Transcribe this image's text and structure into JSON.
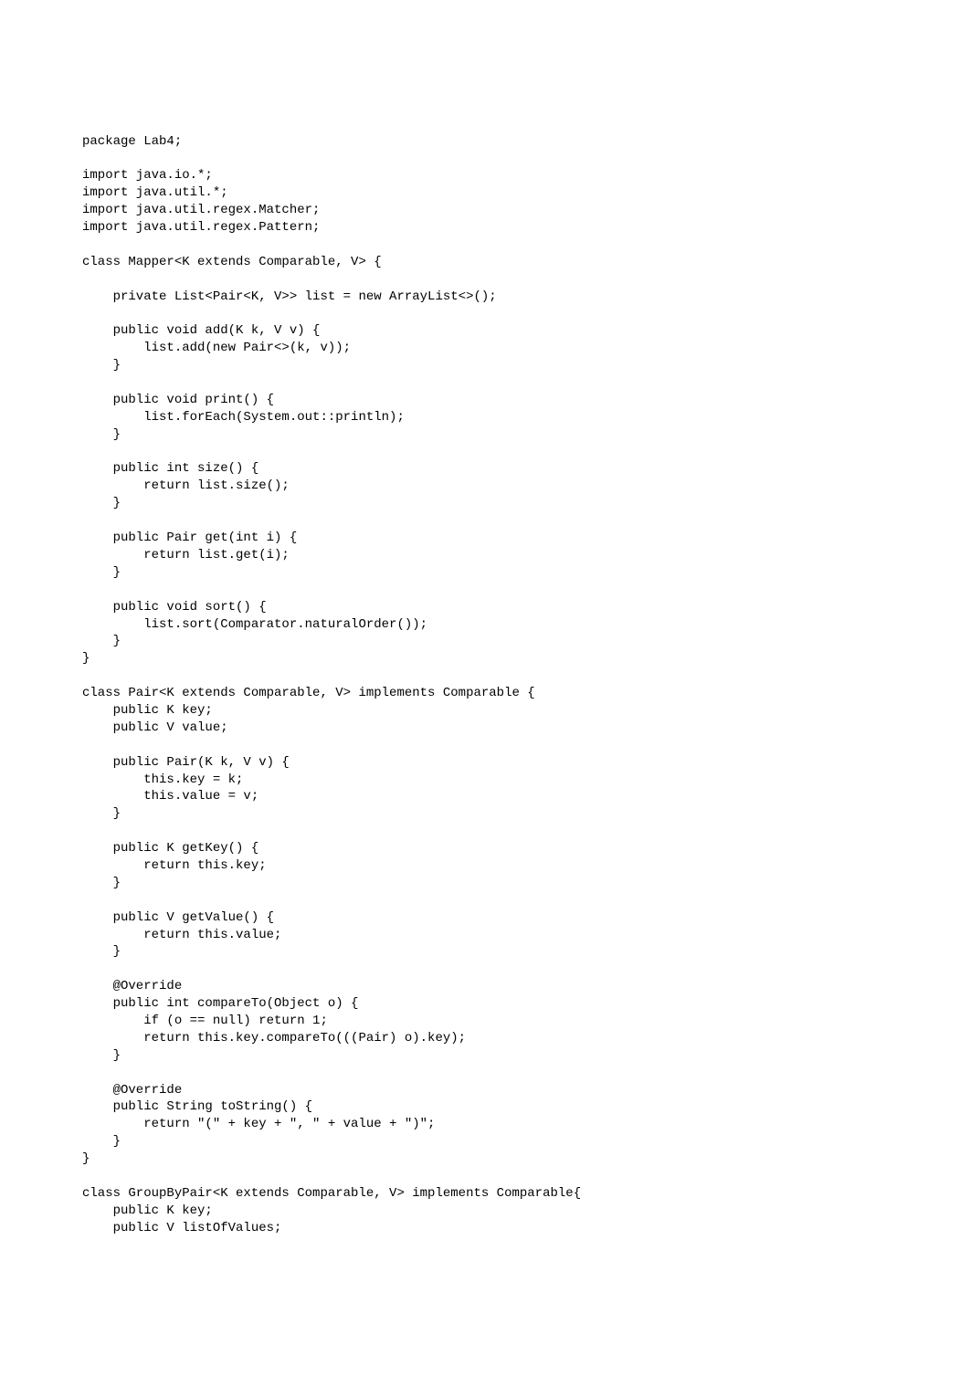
{
  "code": {
    "lines": [
      "package Lab4;",
      "",
      "import java.io.*;",
      "import java.util.*;",
      "import java.util.regex.Matcher;",
      "import java.util.regex.Pattern;",
      "",
      "class Mapper<K extends Comparable, V> {",
      "",
      "    private List<Pair<K, V>> list = new ArrayList<>();",
      "",
      "    public void add(K k, V v) {",
      "        list.add(new Pair<>(k, v));",
      "    }",
      "",
      "    public void print() {",
      "        list.forEach(System.out::println);",
      "    }",
      "",
      "    public int size() {",
      "        return list.size();",
      "    }",
      "",
      "    public Pair get(int i) {",
      "        return list.get(i);",
      "    }",
      "",
      "    public void sort() {",
      "        list.sort(Comparator.naturalOrder());",
      "    }",
      "}",
      "",
      "class Pair<K extends Comparable, V> implements Comparable {",
      "    public K key;",
      "    public V value;",
      "",
      "    public Pair(K k, V v) {",
      "        this.key = k;",
      "        this.value = v;",
      "    }",
      "",
      "    public K getKey() {",
      "        return this.key;",
      "    }",
      "",
      "    public V getValue() {",
      "        return this.value;",
      "    }",
      "",
      "    @Override",
      "    public int compareTo(Object o) {",
      "        if (o == null) return 1;",
      "        return this.key.compareTo(((Pair) o).key);",
      "    }",
      "",
      "    @Override",
      "    public String toString() {",
      "        return \"(\" + key + \", \" + value + \")\";",
      "    }",
      "}",
      "",
      "class GroupByPair<K extends Comparable, V> implements Comparable{",
      "    public K key;",
      "    public V listOfValues;"
    ]
  }
}
